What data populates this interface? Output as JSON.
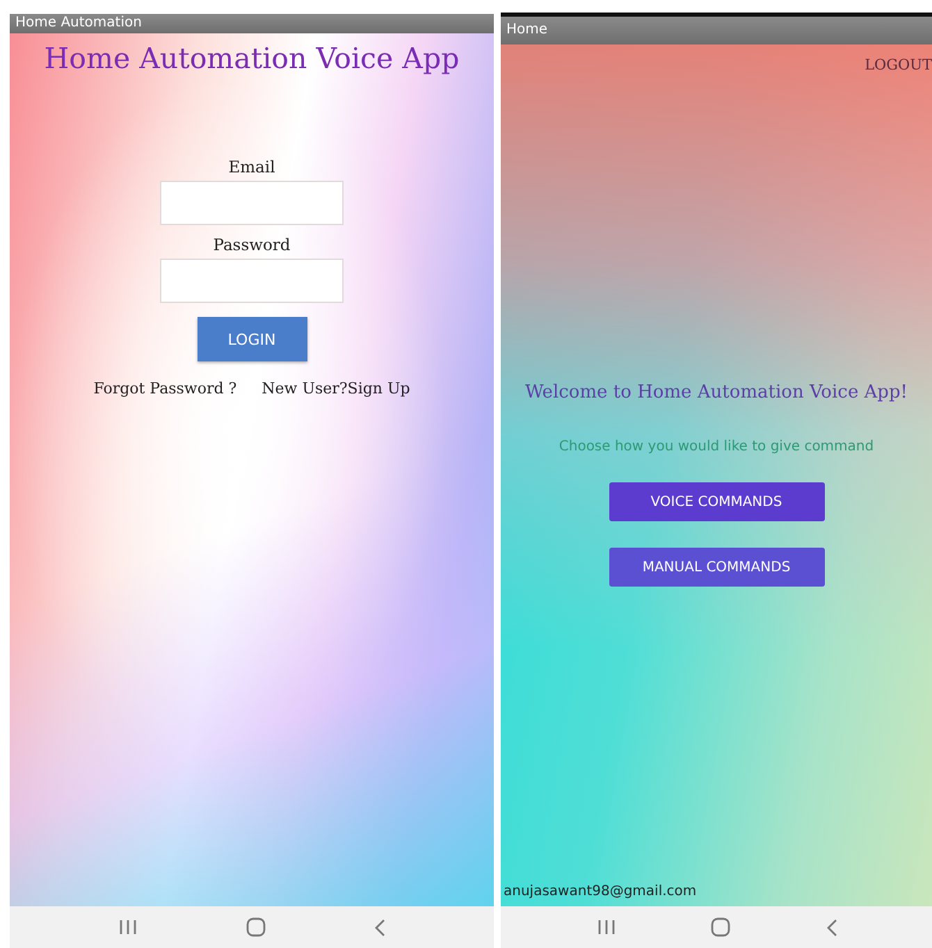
{
  "login_screen": {
    "title_bar": "Home Automation",
    "heading": "Home Automation Voice App",
    "fields": [
      {
        "label": "Email"
      },
      {
        "label": "Password"
      }
    ],
    "login_button": "LOGIN",
    "links": [
      "Forgot Password ?",
      "New User?Sign Up"
    ]
  },
  "home_screen": {
    "title_bar": "Home",
    "logout": "LOGOUT",
    "welcome": "Welcome to Home Automation Voice App!",
    "prompt": "Choose how you would like to give command",
    "buttons": [
      "VOICE COMMANDS",
      "MANUAL COMMANDS"
    ],
    "footer_email": "anujasawant98@gmail.com"
  }
}
